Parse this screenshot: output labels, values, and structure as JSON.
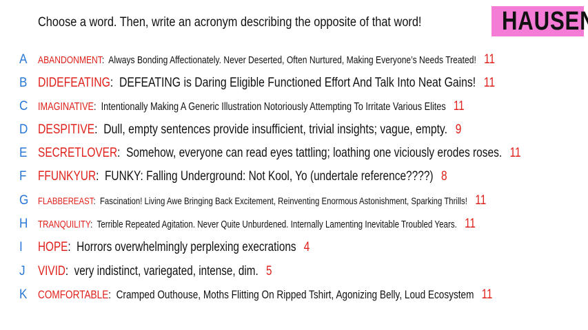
{
  "header": {
    "prompt": "Choose a word. Then, write an acronym describing the opposite of that word!",
    "logo": "HAUSEN"
  },
  "entries": [
    {
      "letter": "A",
      "word": "ABANDONMENT",
      "text": "Always Bonding Affectionately. Never Deserted, Often Nurtured, Making Everyone’s Needs Treated!",
      "count": "11"
    },
    {
      "letter": "B",
      "word": "DIDEFEATING",
      "text": "DEFEATING is Daring Eligible Functioned Effort And Talk Into Neat Gains!",
      "count": "11"
    },
    {
      "letter": "C",
      "word": "IMAGINATIVE",
      "text": "Intentionally Making A Generic Illustration Notoriously Attempting To Irritate Various Elites",
      "count": "11"
    },
    {
      "letter": "D",
      "word": "DESPITIVE",
      "text": "Dull, empty sentences provide insufficient, trivial insights; vague, empty.",
      "count": "9"
    },
    {
      "letter": "E",
      "word": "SECRETLOVER",
      "text": "Somehow, everyone can read eyes tattling; loathing one viciously erodes roses.",
      "count": "11"
    },
    {
      "letter": "F",
      "word": "FFUNKYUR",
      "text": "FUNKY: Falling Underground: Not Kool, Yo (undertale reference????)",
      "count": "8"
    },
    {
      "letter": "G",
      "word": "FLABBEREAST",
      "text": "Fascination! Living Awe Bringing Back Excitement, Reinventing Enormous Astonishment, Sparking Thrills!",
      "count": "11"
    },
    {
      "letter": "H",
      "word": "TRANQUILITY",
      "text": "Terrible Repeated Agitation. Never Quite Unburdened. Internally Lamenting Inevitable Troubled Years.",
      "count": "11"
    },
    {
      "letter": "I",
      "word": "HOPE",
      "text": "Horrors overwhelmingly perplexing execrations",
      "count": "4"
    },
    {
      "letter": "J",
      "word": "VIVID",
      "text": "very indistinct, variegated, intense, dim.",
      "count": "5"
    },
    {
      "letter": "K",
      "word": "COMFORTABLE",
      "text": "Cramped Outhouse, Moths Flitting On Ripped Tshirt, Agonizing Belly, Loud Ecosystem",
      "count": "11"
    }
  ],
  "colors": {
    "letter": "#2a78d6",
    "word": "#e0201b",
    "count": "#e0201b",
    "logo_bg": "#f47bd6"
  }
}
